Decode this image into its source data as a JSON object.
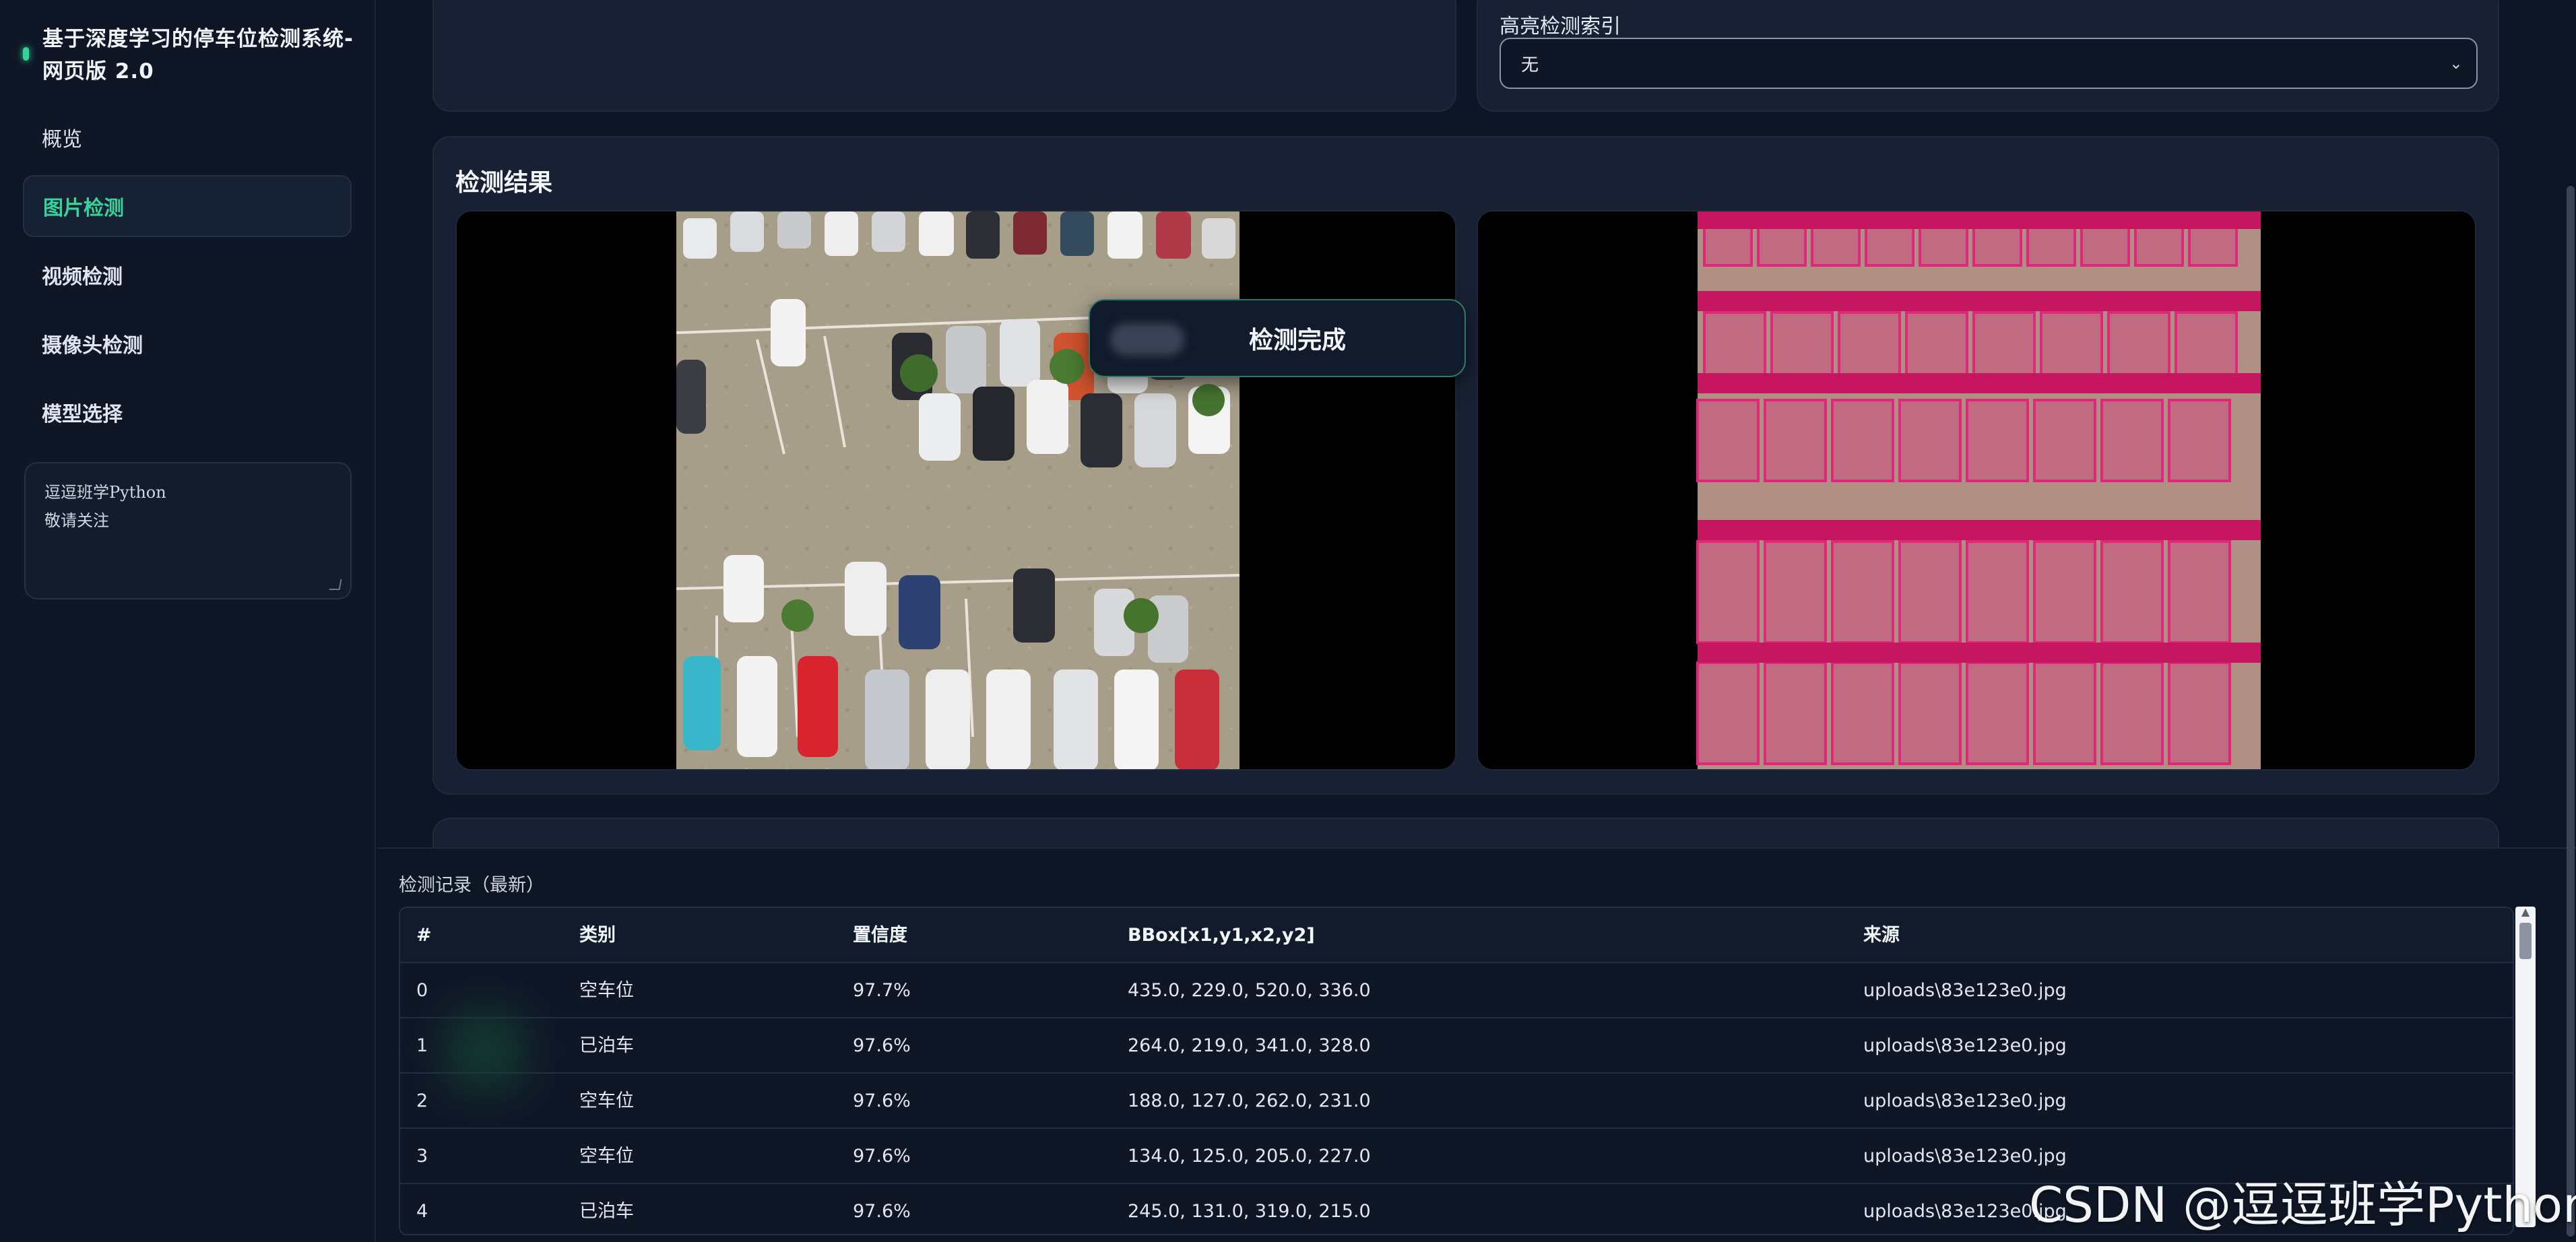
{
  "sidebar": {
    "title": "基于深度学习的停车位检测系统-网页版 2.0",
    "nav": [
      {
        "label": "概览"
      },
      {
        "label": "图片检测"
      },
      {
        "label": "视频检测"
      },
      {
        "label": "摄像头检测"
      },
      {
        "label": "模型选择"
      }
    ],
    "note": "逗逗班学Python\n敬请关注"
  },
  "highlight": {
    "label": "高亮检测索引",
    "value": "无"
  },
  "results": {
    "title": "检测结果",
    "toast": "检测完成",
    "original_image_icon": "parking-lot-photo",
    "annotated_image_icon": "parking-lot-detections"
  },
  "records": {
    "title": "检测记录（最新）",
    "columns": [
      "#",
      "类别",
      "置信度",
      "BBox[x1,y1,x2,y2]",
      "来源"
    ],
    "rows": [
      [
        "0",
        "空车位",
        "97.7%",
        "435.0, 229.0, 520.0, 336.0",
        "uploads\\83e123e0.jpg"
      ],
      [
        "1",
        "已泊车",
        "97.6%",
        "264.0, 219.0, 341.0, 328.0",
        "uploads\\83e123e0.jpg"
      ],
      [
        "2",
        "空车位",
        "97.6%",
        "188.0, 127.0, 262.0, 231.0",
        "uploads\\83e123e0.jpg"
      ],
      [
        "3",
        "空车位",
        "97.6%",
        "134.0, 125.0, 205.0, 227.0",
        "uploads\\83e123e0.jpg"
      ],
      [
        "4",
        "已泊车",
        "97.6%",
        "245.0, 131.0, 319.0, 215.0",
        "uploads\\83e123e0.jpg"
      ]
    ]
  },
  "watermark": "CSDN @逗逗班学Python",
  "colors": {
    "accent": "#34d49a",
    "background": "#0e1626",
    "card": "#172133",
    "detect_box": "#e0287a"
  }
}
